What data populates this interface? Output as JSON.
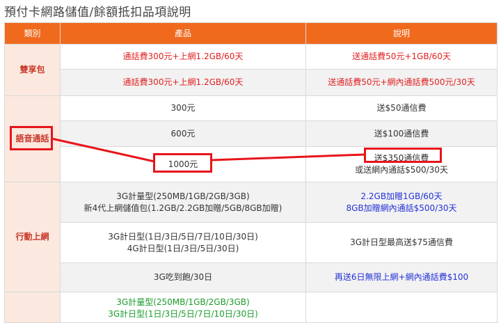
{
  "page_title": "預付卡網路儲值/餘額抵扣品項說明",
  "header": {
    "category": "類別",
    "product": "產品",
    "description": "說明"
  },
  "rows": {
    "r1": {
      "category": "雙享包",
      "product": "通話費300元+上網1.2GB/60天",
      "desc": "送通話費50元+1GB/60天"
    },
    "r2": {
      "product": "通話費300元+上網1.2GB/60天",
      "desc": "送通話費50元+網內通話費500元/30天"
    },
    "r3": {
      "category": "語音通話",
      "product": "300元",
      "desc": "送$50通信費"
    },
    "r4": {
      "product": "600元",
      "desc": "送$100通信費"
    },
    "r5": {
      "product": "1000元",
      "desc1": "送$350通信費",
      "desc2": "或送網內通話$500/30天"
    },
    "r6": {
      "category": "行動上網",
      "product1": "3G計量型(250MB/1GB/2GB/3GB)",
      "product2": "新4代上網儲值包(1.2GB/2.2GB加贈/5GB/8GB加贈)",
      "desc1": "2.2GB加贈1GB/60天",
      "desc2": "8GB加贈網內通話$500/30天"
    },
    "r7": {
      "product1": "3G計日型(1日/3日/5日/7日/10日/30日)",
      "product2": "4G計日型(1日/3日/5日/30日)",
      "desc": "3G計日型最高送$75通信費"
    },
    "r8": {
      "product": "3G吃到飽/30日",
      "desc": "再送6日無限上網+網內通話費$100"
    },
    "r9": {
      "product1": "3G計量型(250MB/1GB/2GB/3GB)",
      "product2": "3G計日型(1日/3日/5日/7日/10日/30日)"
    }
  },
  "colors": {
    "header_bg": "#f06a1e",
    "category_bg": "#fbe8de",
    "highlight": "#e8141b",
    "promo_red": "#e02020",
    "promo_blue": "#2431d8",
    "promo_green": "#1a9b2a"
  }
}
